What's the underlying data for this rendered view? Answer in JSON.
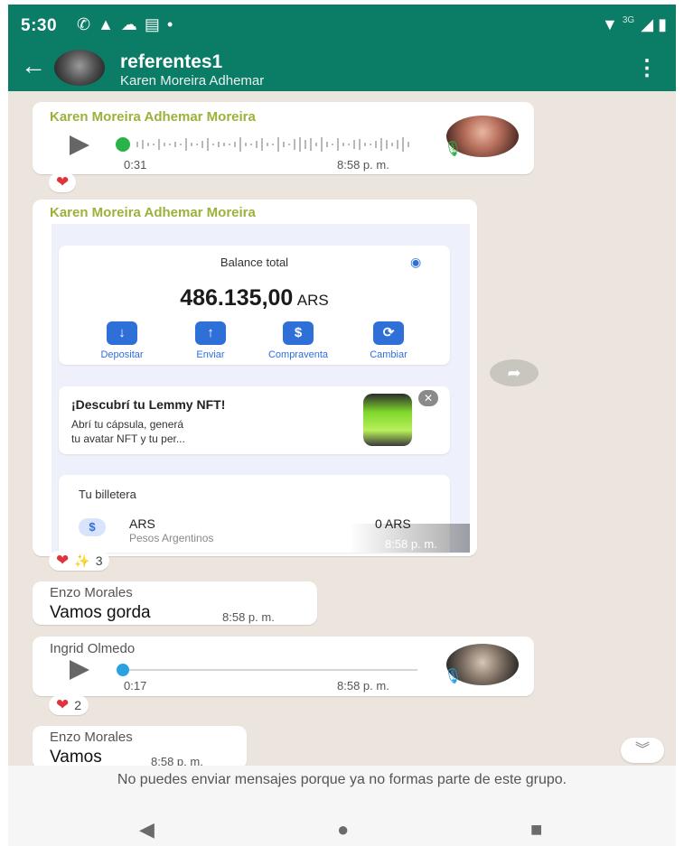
{
  "status_bar": {
    "time": "5:30",
    "left_icons": [
      "whatsapp-icon",
      "alert-icon",
      "cloud-icon",
      "message-icon",
      "dot-icon"
    ],
    "network_label": "3G",
    "right_icons": [
      "wifi-icon",
      "signal-icon",
      "battery-icon"
    ]
  },
  "header": {
    "title": "referentes1",
    "subtitle": "Karen Moreira Adhemar",
    "menu_icon": "more-vert-icon",
    "back_icon": "arrow-back-icon"
  },
  "messages": [
    {
      "type": "audio",
      "sender": "Karen Moreira Adhemar Moreira",
      "duration": "0:31",
      "time": "8:58 p. m.",
      "progress": 0.0,
      "reactions": {
        "emoji": "❤️",
        "count": ""
      }
    },
    {
      "type": "image",
      "sender": "Karen Moreira Adhemar Moreira",
      "time": "8:58 p. m.",
      "image": {
        "balance_label": "Balance total",
        "balance_amount": "486.135,00",
        "balance_currency": "ARS",
        "actions": [
          {
            "label": "Depositar",
            "icon": "arrow-down-icon",
            "glyph": "↓"
          },
          {
            "label": "Enviar",
            "icon": "arrow-up-icon",
            "glyph": "↑"
          },
          {
            "label": "Compraventa",
            "icon": "dollar-icon",
            "glyph": "$"
          },
          {
            "label": "Cambiar",
            "icon": "refresh-icon",
            "glyph": "⟳"
          }
        ],
        "promo_title": "¡Descubrí tu Lemmy NFT!",
        "promo_text_line1": "Abrí tu cápsula, generá",
        "promo_text_line2": "tu avatar NFT y tu per...",
        "wallet_title": "Tu billetera",
        "wallet_currency": "ARS",
        "wallet_currency_name": "Pesos Argentinos",
        "wallet_amount": "0 ARS"
      },
      "reactions": {
        "emoji": "❤️ ✨",
        "count": "3"
      }
    },
    {
      "type": "text",
      "sender": "Enzo Morales",
      "text": "Vamos gorda",
      "time": "8:58 p. m."
    },
    {
      "type": "audio",
      "sender": "Ingrid Olmedo",
      "duration": "0:17",
      "time": "8:58 p. m.",
      "progress": 0.0,
      "reactions": {
        "emoji": "❤️",
        "count": "2"
      }
    },
    {
      "type": "text",
      "sender": "Enzo Morales",
      "text": "Vamos",
      "time": "8:58 p. m."
    }
  ],
  "footer": {
    "notice": "No puedes enviar mensajes porque ya no formas parte de este grupo."
  },
  "nav_bar": [
    "back-nav-icon",
    "home-nav-icon",
    "recents-nav-icon"
  ],
  "colors": {
    "header": "#0b7d66",
    "chat_bg": "#ece5dd",
    "sender_green": "#9ab23b",
    "app_blue": "#2f6fd8",
    "heart": "#e0333b"
  }
}
